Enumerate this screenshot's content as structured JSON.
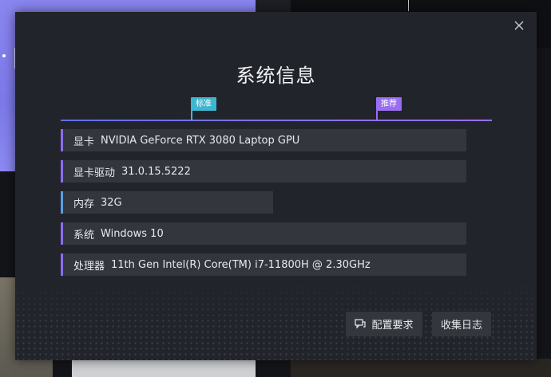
{
  "dialog": {
    "title": "系统信息",
    "scale": {
      "standard_tag": "标准",
      "recommended_tag": "推荐",
      "standard_color": "#3fb6cf",
      "recommended_color": "#9a6ef0"
    },
    "rows": [
      {
        "label": "显卡",
        "value": "NVIDIA GeForce RTX 3080 Laptop GPU",
        "accent": "#8b6cf0"
      },
      {
        "label": "显卡驱动",
        "value": "31.0.15.5222",
        "accent": "#8b6cf0"
      },
      {
        "label": "内存",
        "value": "32G",
        "accent": "#5d9ee6"
      },
      {
        "label": "系统",
        "value": "Windows 10",
        "accent": "#8b6cf0"
      },
      {
        "label": "处理器",
        "value": "11th Gen Intel(R) Core(TM) i7-11800H @ 2.30GHz",
        "accent": "#8b6cf0"
      }
    ],
    "buttons": {
      "requirements_label": "配置要求",
      "requirements_icon": "chat-icon",
      "collect_logs_label": "收集日志"
    },
    "close_icon": "close-icon"
  }
}
